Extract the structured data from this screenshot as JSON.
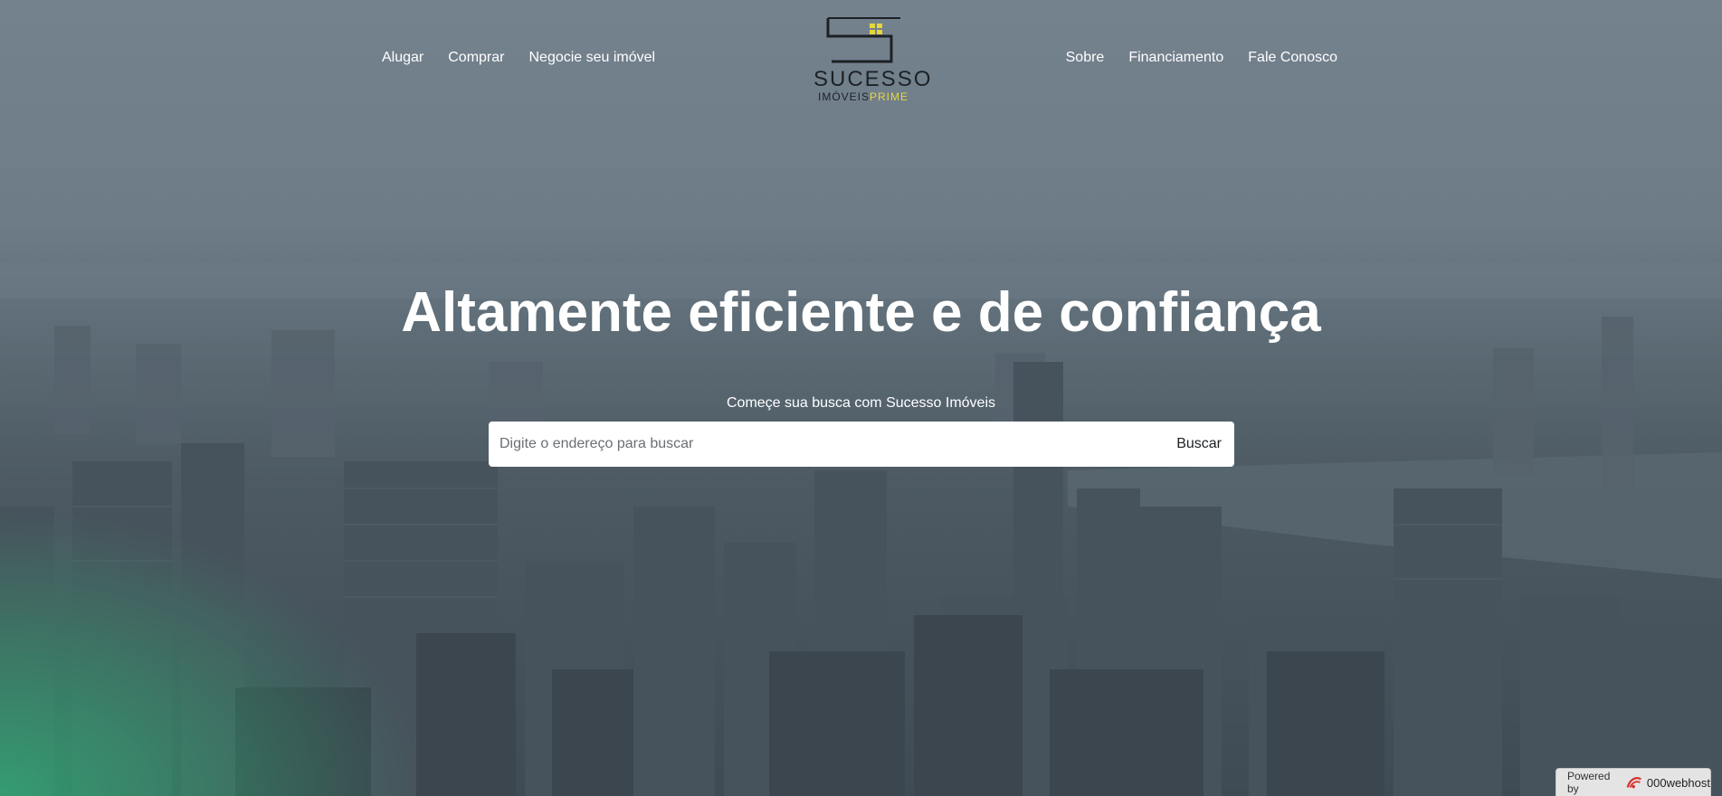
{
  "nav": {
    "left": [
      {
        "label": "Alugar"
      },
      {
        "label": "Comprar"
      },
      {
        "label": "Negocie seu imóvel"
      }
    ],
    "right": [
      {
        "label": "Sobre"
      },
      {
        "label": "Financiamento"
      },
      {
        "label": "Fale Conosco"
      }
    ]
  },
  "logo": {
    "brand": "SUCESSO",
    "sub_main": "IMÓVEIS",
    "sub_accent": "PRIME",
    "accent_color": "#e7d63a"
  },
  "hero": {
    "headline": "Altamente eficiente e de confiança",
    "tagline": "Começe sua busca com Sucesso Imóveis"
  },
  "search": {
    "placeholder": "Digite o endereço para buscar",
    "button_label": "Buscar"
  },
  "badge": {
    "prefix": "Powered by",
    "brand": "000webhost"
  }
}
